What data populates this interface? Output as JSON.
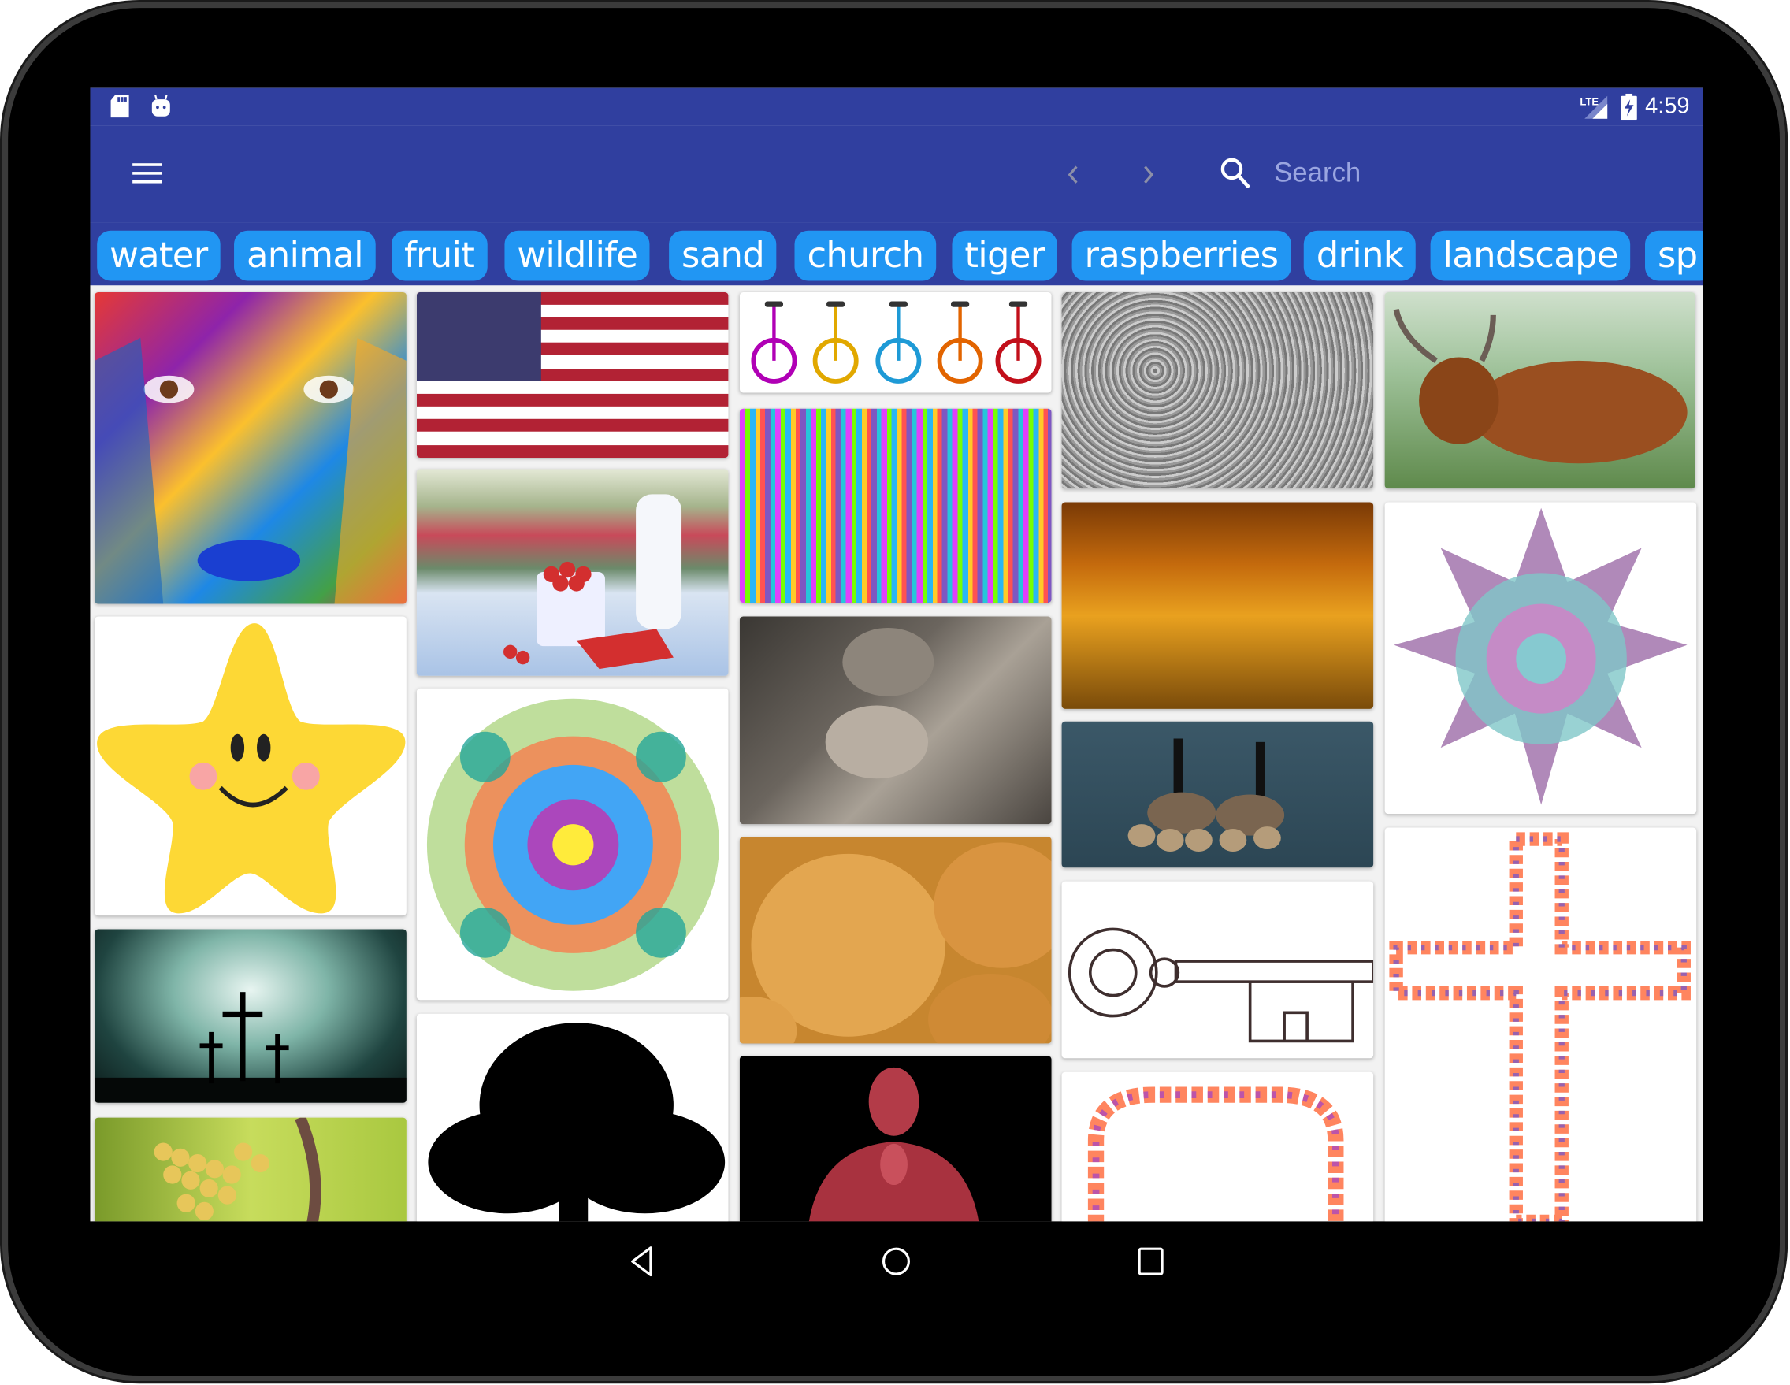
{
  "status_bar": {
    "left_icons": [
      "sd-card-icon",
      "android-debug-icon"
    ],
    "right_icons": [
      "lte-signal-icon",
      "battery-charging-icon"
    ],
    "network_label": "LTE",
    "time": "4:59"
  },
  "toolbar": {
    "menu_icon": "hamburger-menu-icon",
    "back_icon": "chevron-left-icon",
    "forward_icon": "chevron-right-icon",
    "search_icon": "search-icon",
    "search_placeholder": "Search"
  },
  "chips": [
    {
      "label": "water"
    },
    {
      "label": "animal"
    },
    {
      "label": "fruit"
    },
    {
      "label": "wildlife"
    },
    {
      "label": "sand"
    },
    {
      "label": "church"
    },
    {
      "label": "tiger"
    },
    {
      "label": "raspberries"
    },
    {
      "label": "drink"
    },
    {
      "label": "landscape"
    },
    {
      "label": "sp"
    }
  ],
  "grid": {
    "columns": [
      {
        "tiles": [
          {
            "name": "painted-face-photo",
            "desc": "colorful painted face"
          },
          {
            "name": "smiling-star-clipart",
            "desc": "yellow smiling star"
          },
          {
            "name": "three-crosses-photo",
            "desc": "three crosses against glowing sky"
          },
          {
            "name": "grapes-photo",
            "desc": "yellow grapes on vine"
          }
        ]
      },
      {
        "tiles": [
          {
            "name": "us-flag-image",
            "desc": "American flag"
          },
          {
            "name": "cherry-tomatoes-milk-photo",
            "desc": "cherry tomatoes and milk bottle"
          },
          {
            "name": "psychedelic-mandala-image",
            "desc": "colorful floral mandala"
          },
          {
            "name": "tree-silhouette-image",
            "desc": "black tree silhouette"
          }
        ]
      },
      {
        "tiles": [
          {
            "name": "unicycles-clipart",
            "desc": "five colored unicycles"
          },
          {
            "name": "colorful-pattern-image",
            "desc": "rainbow tile pattern"
          },
          {
            "name": "statue-kiss-photo",
            "desc": "stone statue embrace"
          },
          {
            "name": "bread-rolls-photo",
            "desc": "bread rolls"
          },
          {
            "name": "praying-figure-photo",
            "desc": "red figure praying"
          }
        ]
      },
      {
        "tiles": [
          {
            "name": "gray-texture-image",
            "desc": "gray noise texture"
          },
          {
            "name": "golden-grass-photo",
            "desc": "golden grass at sunset"
          },
          {
            "name": "geese-photo",
            "desc": "geese on water"
          },
          {
            "name": "ornate-key-clipart",
            "desc": "ornate key outline"
          },
          {
            "name": "floral-arch-clipart",
            "desc": "floral arch frame"
          }
        ]
      },
      {
        "tiles": [
          {
            "name": "highland-cow-photo",
            "desc": "highland cow in grass"
          },
          {
            "name": "mandala-star-image",
            "desc": "pastel star mandala"
          },
          {
            "name": "floral-cross-clipart",
            "desc": "floral outlined cross"
          }
        ]
      }
    ]
  },
  "nav_bar": {
    "back_icon": "nav-back-icon",
    "home_icon": "nav-home-icon",
    "recents_icon": "nav-recents-icon"
  },
  "colors": {
    "app_bar": "#303f9f",
    "chip": "#2196f3",
    "chip_text": "#ffffff",
    "search_placeholder": "#9aa5e0",
    "grid_bg": "#f2f2f2"
  }
}
